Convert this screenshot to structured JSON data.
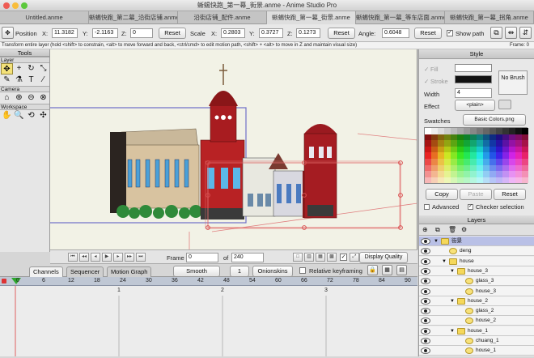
{
  "window": {
    "title": "蜥蜴快跑_第一幕_街景.anme - Anime Studio Pro"
  },
  "tabs": [
    "Untitled.anme",
    "蜥蜴快跑_第二幕_沿街店铺.anme",
    "沿街店铺_配件.anme",
    "蜥蜴快跑_第一幕_街景.anme",
    "蜥蜴快跑_第一幕_等车店面.anme",
    "蜥蜴快跑_第一幕_拐角.anme"
  ],
  "toolbar": {
    "position_label": "Position",
    "x_label": "X:",
    "y_label": "Y:",
    "z_label": "Z:",
    "pos_x": "11.3182",
    "pos_y": "-2.1163",
    "pos_z": "0",
    "reset": "Reset",
    "scale_label": "Scale",
    "scale_x": "0.2803",
    "scale_y": "0.3727",
    "scale_z": "0.1273",
    "angle_label": "Angle:",
    "angle": "0.6048",
    "show_path": "Show path"
  },
  "status": {
    "text": "Transform entire layer (hold <shift> to constrain, <alt> to move forward and back, <ctrl/cmd> to edit motion path, <shift> + <alt> to move in Z and maintain visual size)",
    "frame_text": "Frame: 0"
  },
  "tools": {
    "title": "Tools",
    "layer": "Layer",
    "camera": "Camera",
    "workspace": "Workspace"
  },
  "playback": {
    "frame_label": "Frame",
    "frame": "0",
    "of_label": "of",
    "total": "240",
    "display_quality": "Display Quality"
  },
  "timeline": {
    "tabs": [
      "Channels",
      "Sequencer",
      "Motion Graph"
    ],
    "smooth": "Smooth",
    "one": "1",
    "onionskins": "Onionskins",
    "relative_kf": "Relative keyframing",
    "ruler": [
      "0",
      "6",
      "12",
      "18",
      "24",
      "30",
      "36",
      "42",
      "48",
      "54",
      "60",
      "66",
      "72",
      "78",
      "84",
      "90"
    ],
    "markers": [
      "1",
      "2",
      "3"
    ]
  },
  "style": {
    "title": "Style",
    "fill": "Fill",
    "stroke": "Stroke",
    "width_label": "Width",
    "width": "4",
    "effect_label": "Effect",
    "effect": "<plain>",
    "no_brush": "No Brush",
    "swatches_label": "Swatches",
    "swatches_value": "Basic Colors.png",
    "copy": "Copy",
    "paste": "Paste",
    "reset": "Reset",
    "advanced": "Advanced",
    "checker": "Checker selection"
  },
  "layers": {
    "title": "Layers",
    "rows": [
      {
        "name": "街景",
        "indent": 0,
        "folder": true,
        "open": true,
        "selected": true
      },
      {
        "name": "deng",
        "indent": 1,
        "folder": false
      },
      {
        "name": "house",
        "indent": 1,
        "folder": true,
        "open": true
      },
      {
        "name": "house_3",
        "indent": 2,
        "folder": true,
        "open": true
      },
      {
        "name": "glass_3",
        "indent": 3,
        "folder": false
      },
      {
        "name": "house_3",
        "indent": 3,
        "folder": false
      },
      {
        "name": "house_2",
        "indent": 2,
        "folder": true,
        "open": true
      },
      {
        "name": "glass_2",
        "indent": 3,
        "folder": false
      },
      {
        "name": "house_2",
        "indent": 3,
        "folder": false
      },
      {
        "name": "house_1",
        "indent": 2,
        "folder": true,
        "open": true
      },
      {
        "name": "chuang_1",
        "indent": 3,
        "folder": false
      },
      {
        "name": "house_1",
        "indent": 3,
        "folder": false
      }
    ]
  },
  "colors": {
    "selection": "#b9c0e6",
    "ruler": "#bfc7d4",
    "keyframe_green": "#2ea82e"
  }
}
